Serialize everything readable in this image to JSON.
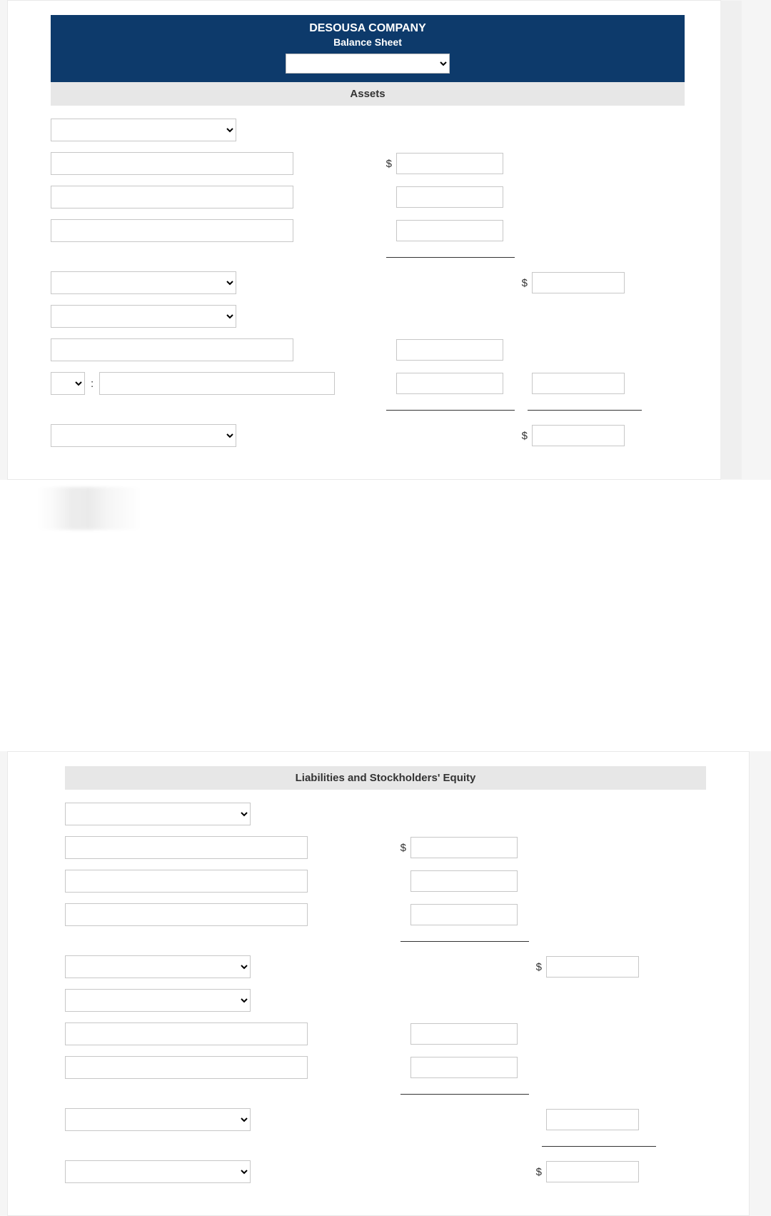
{
  "header": {
    "company": "DESOUSA COMPANY",
    "title": "Balance Sheet",
    "date_select_value": ""
  },
  "sections": {
    "assets_title": "Assets",
    "liabilities_title": "Liabilities and Stockholders' Equity"
  },
  "assets": {
    "category1_select": "",
    "line1_label": "",
    "line1_amount": "",
    "line2_label": "",
    "line2_amount": "",
    "line3_label": "",
    "line3_amount": "",
    "subtotal1_select": "",
    "subtotal1_amount": "",
    "category2_select": "",
    "line4_label": "",
    "line4_amount": "",
    "less_select": "",
    "less_colon": ":",
    "less_label": "",
    "less_amount": "",
    "category2_total": "",
    "total_select": "",
    "total_amount": ""
  },
  "liabilities": {
    "category1_select": "",
    "line1_label": "",
    "line1_amount": "",
    "line2_label": "",
    "line2_amount": "",
    "line3_label": "",
    "line3_amount": "",
    "subtotal1_select": "",
    "subtotal1_amount": "",
    "category2_select": "",
    "line4_label": "",
    "line4_amount": "",
    "line5_label": "",
    "line5_amount": "",
    "subtotal2_select": "",
    "subtotal2_amount": "",
    "total_select": "",
    "total_amount": ""
  },
  "currency_symbol": "$"
}
